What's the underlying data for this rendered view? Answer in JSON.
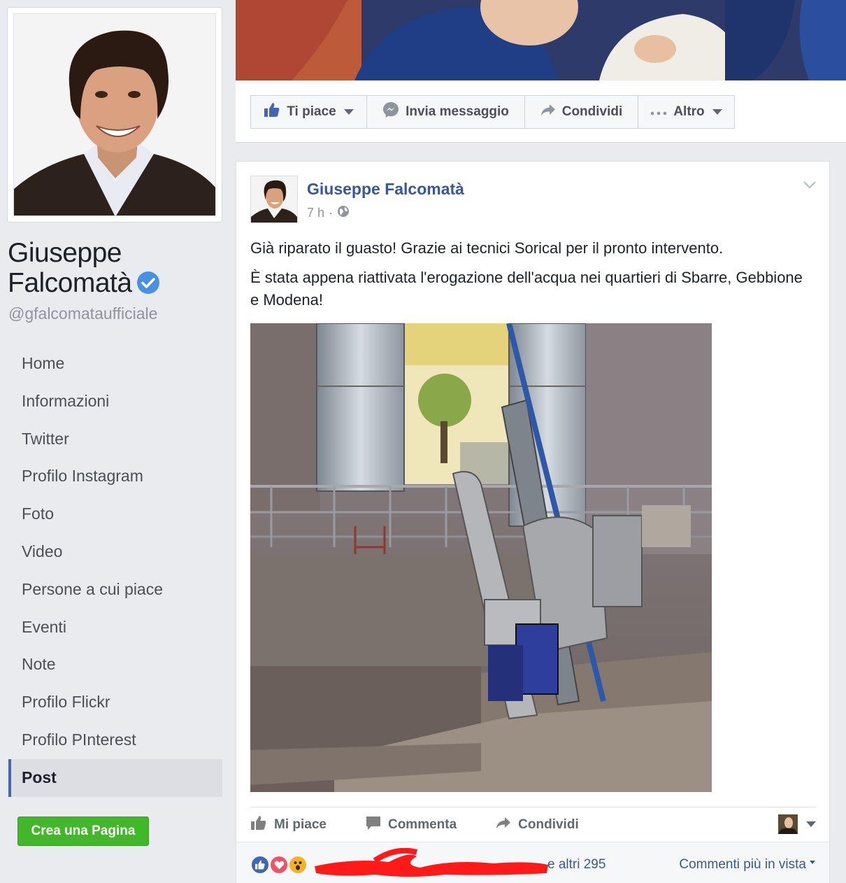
{
  "page": {
    "name_line1": "Giuseppe",
    "name_line2": "Falcomatà",
    "handle": "@gfalcomataufficiale"
  },
  "sidebar": {
    "items": [
      {
        "label": "Home"
      },
      {
        "label": "Informazioni"
      },
      {
        "label": "Twitter"
      },
      {
        "label": "Profilo Instagram"
      },
      {
        "label": "Foto"
      },
      {
        "label": "Video"
      },
      {
        "label": "Persone a cui piace"
      },
      {
        "label": "Eventi"
      },
      {
        "label": "Note"
      },
      {
        "label": "Profilo Flickr"
      },
      {
        "label": "Profilo PInterest"
      },
      {
        "label": "Post"
      }
    ],
    "active_item": "Post",
    "create_page_label": "Crea una Pagina"
  },
  "action_bar": {
    "like": "Ti piace",
    "message": "Invia messaggio",
    "share": "Condividi",
    "more": "Altro"
  },
  "post": {
    "author": "Giuseppe Falcomatà",
    "time": "7 h",
    "visibility_icon": "globe-icon",
    "text_p1": "Già riparato il guasto! Grazie ai tecnici Sorical per il pronto intervento.",
    "text_p2": "È stata appena riattivata l'erogazione dell'acqua nei quartieri di Sbarre, Gebbione e Modena!",
    "actions": {
      "like": "Mi piace",
      "comment": "Commenta",
      "share": "Condividi"
    },
    "reactions": [
      "like",
      "love",
      "wow"
    ],
    "others_text": "e altri 295",
    "sort_comments": "Commenti più in vista"
  },
  "colors": {
    "brand_blue": "#4267b2",
    "link_blue": "#365899",
    "create_green": "#42b72a",
    "love_red": "#f25268",
    "wow_yellow": "#f7b125",
    "redaction_red": "#ff1a1a"
  }
}
